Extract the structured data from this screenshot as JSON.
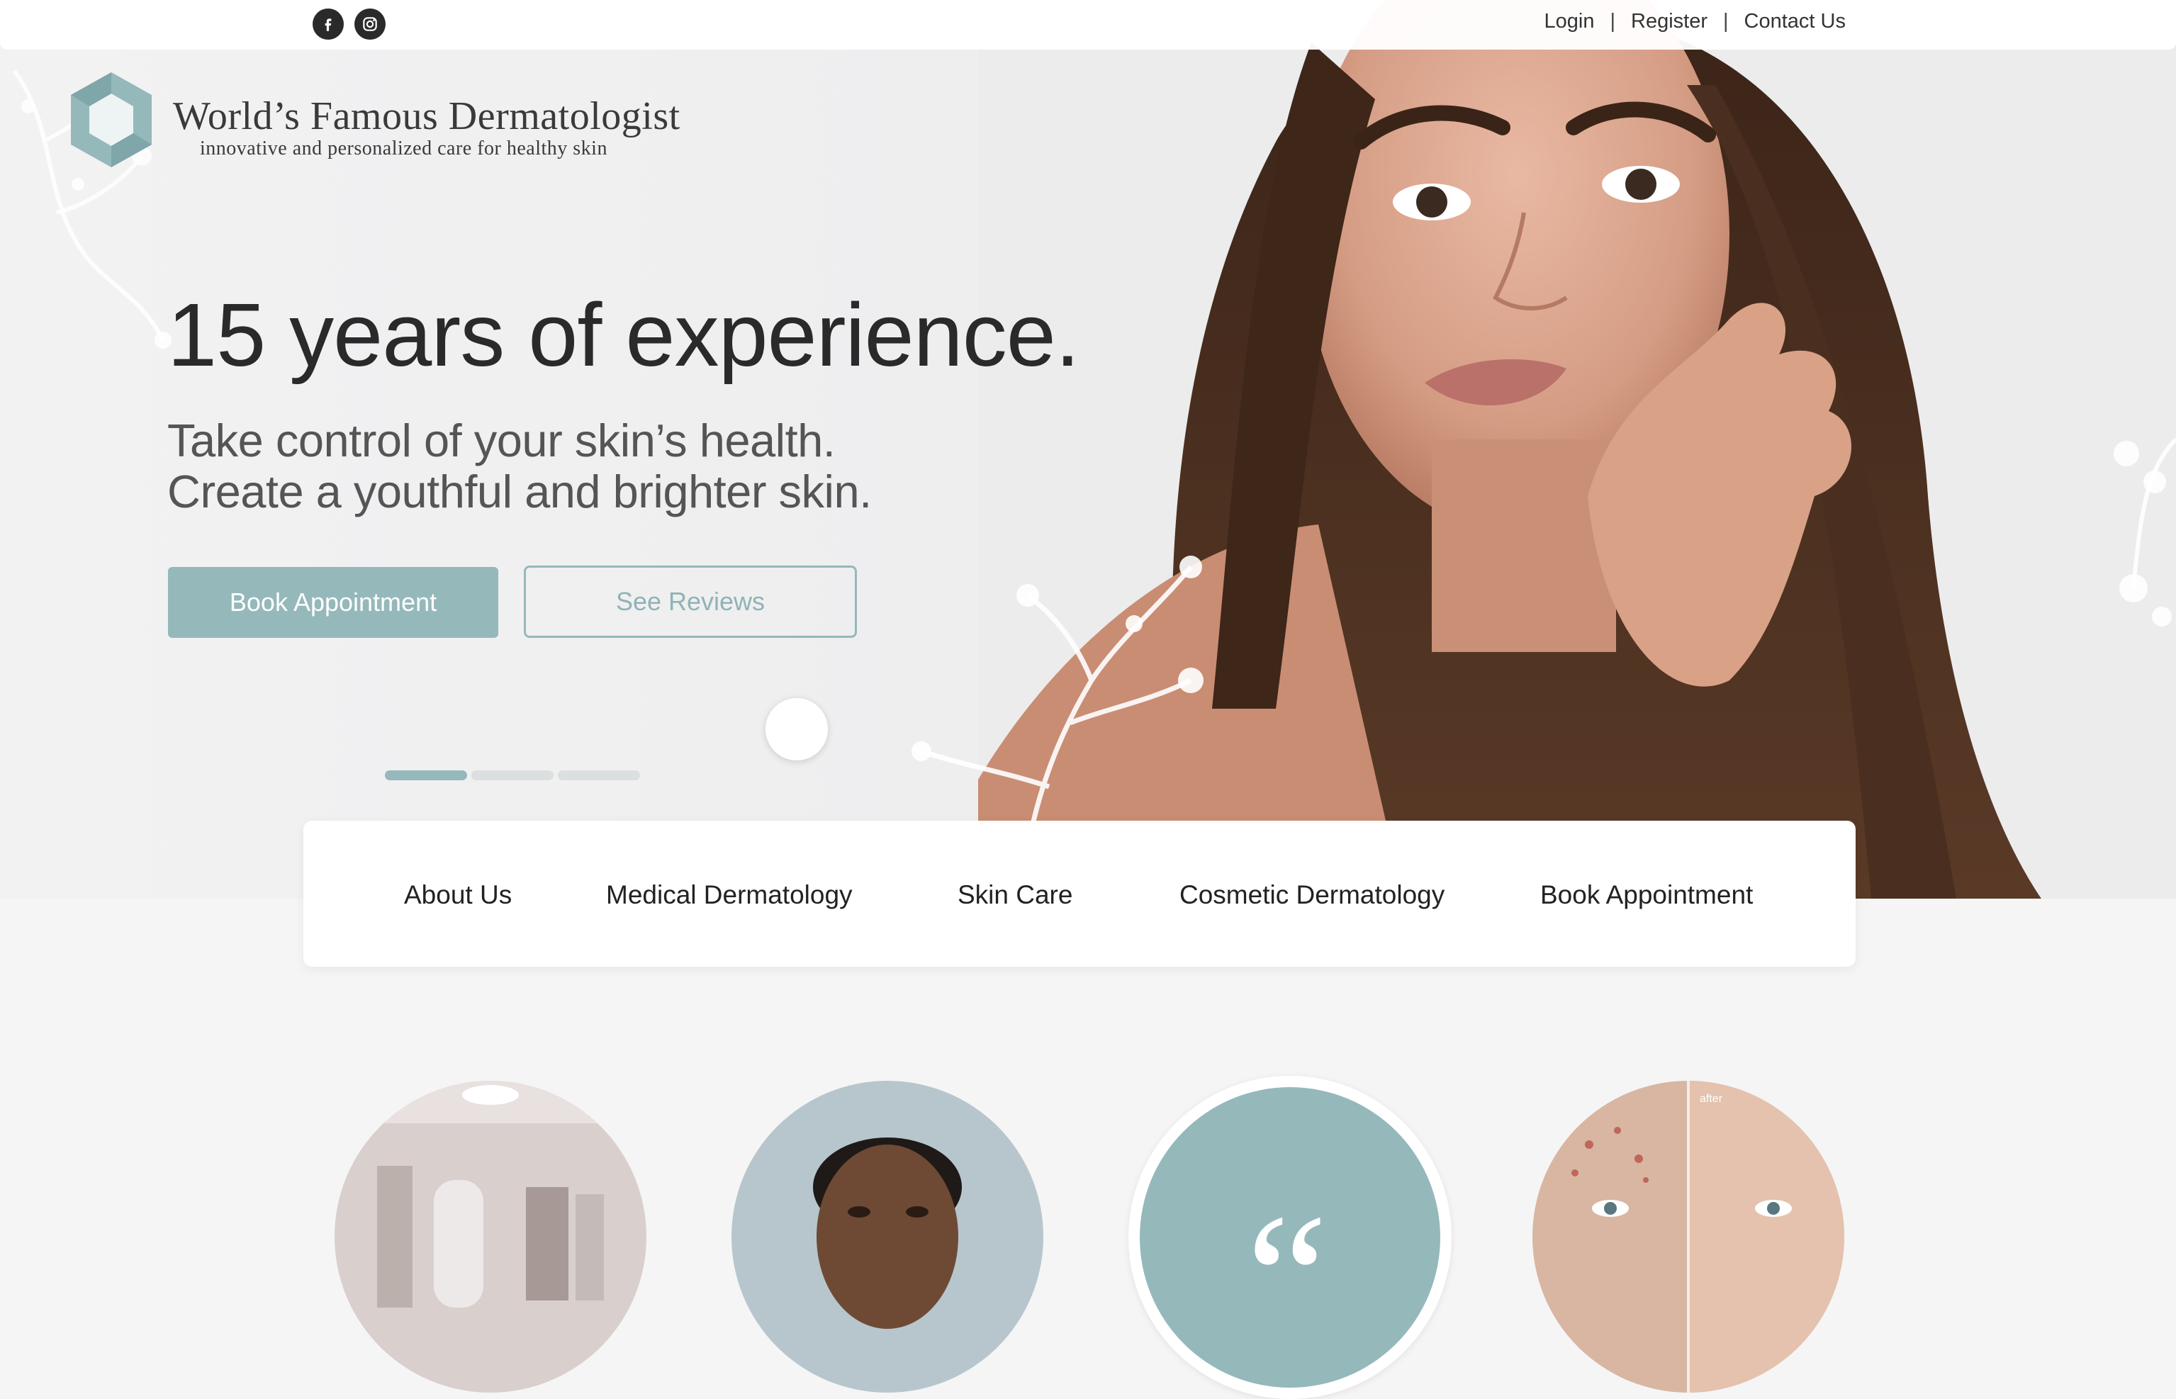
{
  "topbar": {
    "social": [
      "facebook-icon",
      "instagram-icon"
    ],
    "links": {
      "login": "Login",
      "register": "Register",
      "contact": "Contact Us",
      "separator": "|"
    }
  },
  "brand": {
    "name": "World’s Famous Dermatologist",
    "tagline": "innovative and personalized care for healthy skin",
    "accent": "#95b8bb"
  },
  "hero": {
    "headline": "15 years of experience.",
    "sub_line1": "Take control of your skin’s health.",
    "sub_line2": "Create a youthful and brighter skin.",
    "primary_cta": "Book Appointment",
    "secondary_cta": "See Reviews",
    "slides_total": 3,
    "slide_active": 1
  },
  "nav": {
    "items": [
      "About Us",
      "Medical Dermatology",
      "Skin Care",
      "Cosmetic Dermatology",
      "Book Appointment"
    ]
  },
  "features": {
    "quote_glyph": "“",
    "before_after_label": "after"
  }
}
